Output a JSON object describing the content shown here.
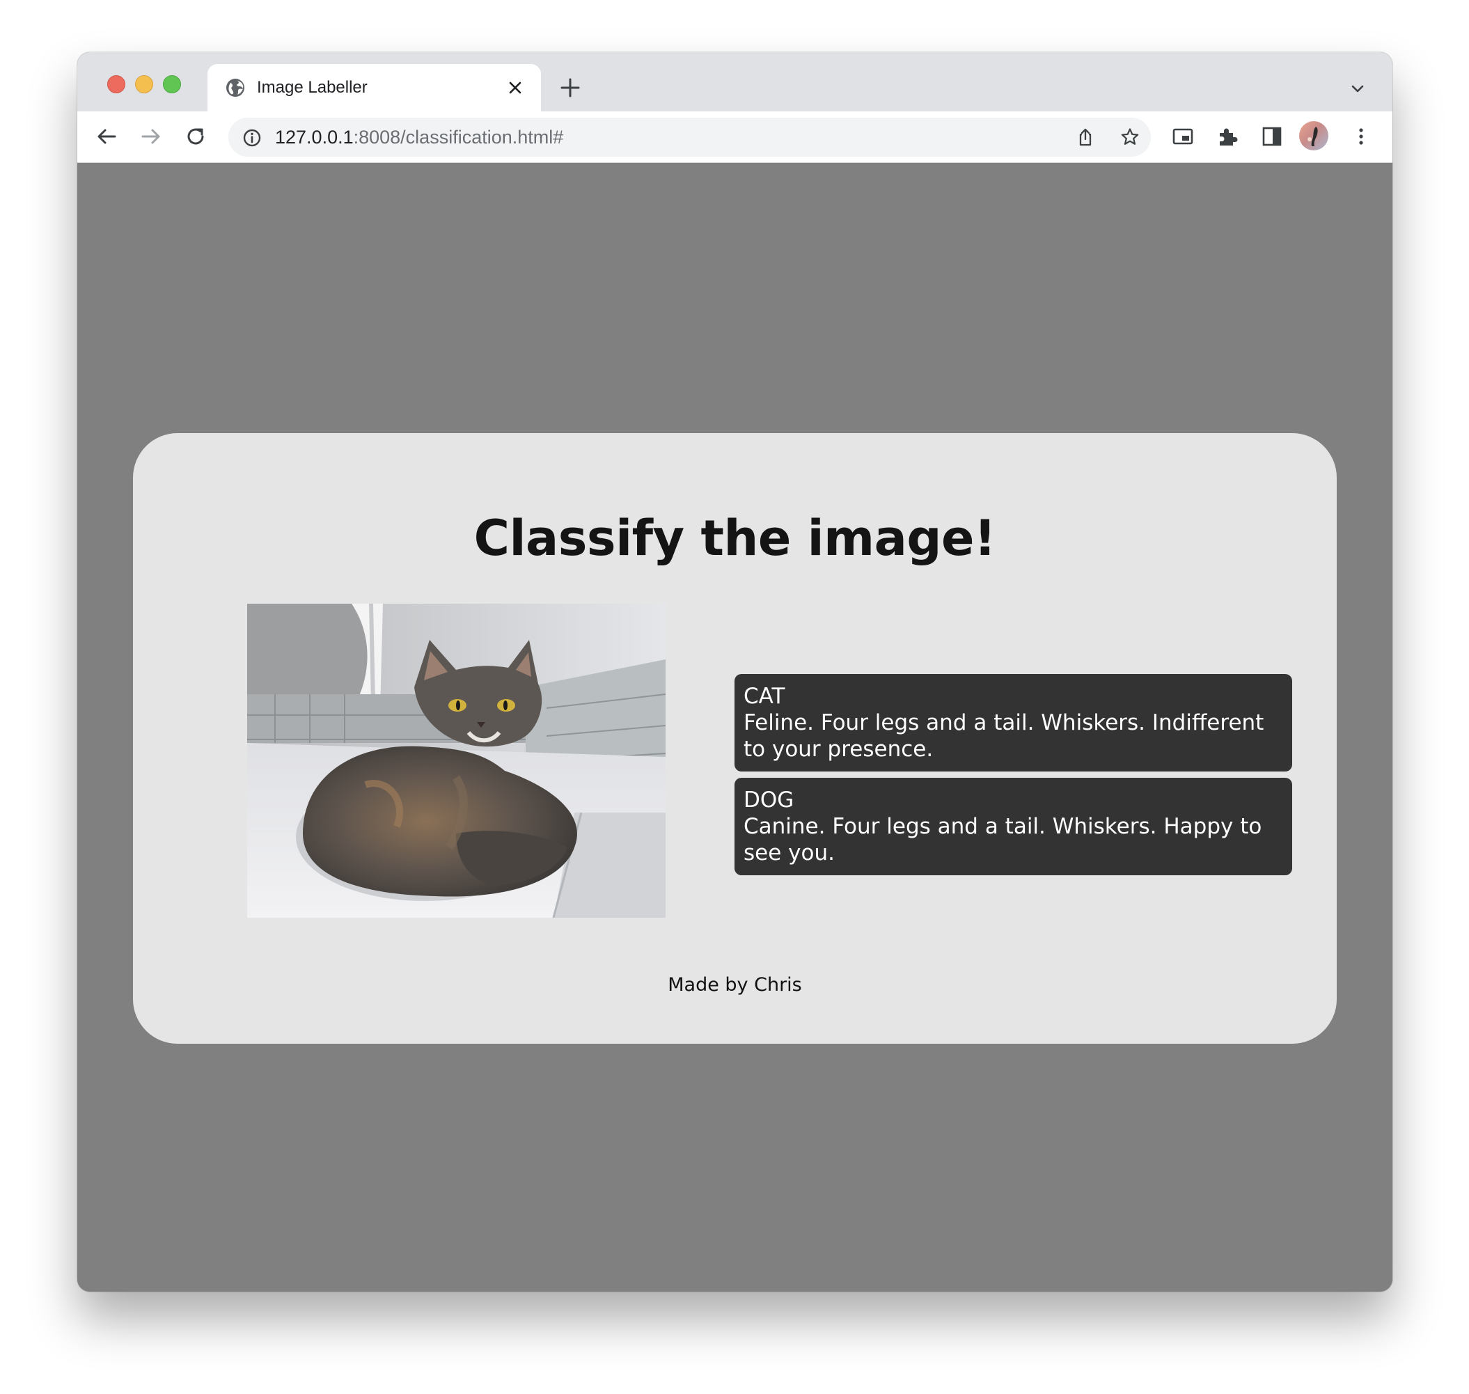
{
  "browser": {
    "tab": {
      "title": "Image Labeller",
      "icon": "globe-icon"
    },
    "address_bar": {
      "host": "127.0.0.1",
      "path": ":8008/classification.html#"
    },
    "icons": [
      "back-icon",
      "forward-icon",
      "reload-icon",
      "info-icon",
      "share-icon",
      "star-icon",
      "picture-in-picture-icon",
      "extensions-icon",
      "side-panel-icon",
      "profile-avatar",
      "more-menu-icon",
      "tab-search-icon",
      "new-tab-icon",
      "close-tab-icon"
    ]
  },
  "page": {
    "title": "Classify the image!",
    "image": {
      "alt": "cat"
    },
    "options": [
      {
        "label": "CAT",
        "description": "Feline. Four legs and a tail. Whiskers. Indifferent to your presence."
      },
      {
        "label": "DOG",
        "description": "Canine. Four legs and a tail. Whiskers. Happy to see you."
      }
    ],
    "footer": "Made by Chris"
  },
  "colors": {
    "page_background": "#808080",
    "card_background": "#e5e5e5",
    "option_background": "#333333",
    "option_text": "#ffffff"
  }
}
